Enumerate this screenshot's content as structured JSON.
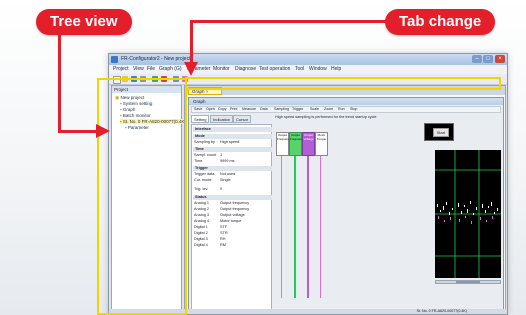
{
  "callouts": {
    "tree_view": "Tree view",
    "tab_change": "Tab change"
  },
  "colors": {
    "callout": "#e41f2b",
    "highlight": "#f4d400",
    "trace_green": "#1bd14a",
    "trace_purple": "#b25fd6",
    "trace_magenta": "#e36bd8",
    "scope_bg": "#000000"
  },
  "window": {
    "title": "FR-Configurator2 - New project",
    "menus": [
      "Project",
      "View",
      "File",
      "Graph (G)",
      "Parameter",
      "Monitor",
      "Diagnose",
      "Test operation",
      "Tool",
      "Window",
      "Help"
    ],
    "tree": {
      "header": "Project",
      "items": [
        "New project",
        "System setting",
        "Graph",
        "Batch monitor",
        "St. No. 0 FR-A820-00077(0.4K)",
        "Parameter"
      ]
    },
    "doc_tab": "Graph",
    "graph_window": {
      "title": "Graph",
      "toolbar_items": [
        "Save",
        "Open",
        "Copy",
        "Print",
        "Measure",
        "Data",
        "Sampling",
        "Trigger",
        "Scale",
        "Zoom",
        "Run",
        "Stop"
      ],
      "status": "High speed sampling is performed for the trend startup cycle",
      "setting_tabs": [
        "Setting",
        "Indication",
        "Cursor"
      ],
      "settings": [
        {
          "group": "Interface"
        },
        {
          "group": "Mode",
          "rows": [
            [
              "Sampling by",
              "High speed"
            ]
          ]
        },
        {
          "group": "Time",
          "rows": [
            [
              "Sampl. count",
              "1"
            ],
            [
              "Time",
              "9999 ms"
            ]
          ]
        },
        {
          "group": "Trigger",
          "rows": [
            [
              "Trigger data",
              "Not used"
            ],
            [
              "Cur. mode",
              "Single"
            ]
          ]
        },
        {
          "group": "",
          "rows": [
            [
              "Trig. lev.",
              "0"
            ]
          ]
        },
        {
          "group": "Status",
          "rows": [
            [
              "Analog 1",
              "Output frequency"
            ],
            [
              "Analog 2",
              "Output frequency"
            ],
            [
              "Analog 3",
              "Output voltage"
            ],
            [
              "Analog 4",
              "Motor torque"
            ],
            [
              "Digital 1",
              "STF"
            ],
            [
              "Digital 2",
              "STR"
            ],
            [
              "Digital 3",
              "RH"
            ],
            [
              "Digital 4",
              "RM"
            ]
          ]
        }
      ],
      "channels": [
        "Output Frequency",
        "Output Frequency",
        "Output Voltage",
        "Motor Torque"
      ],
      "start_button": "Start"
    },
    "statusbar": "St. No. 0 FR-A820-00077(0.4K)"
  }
}
